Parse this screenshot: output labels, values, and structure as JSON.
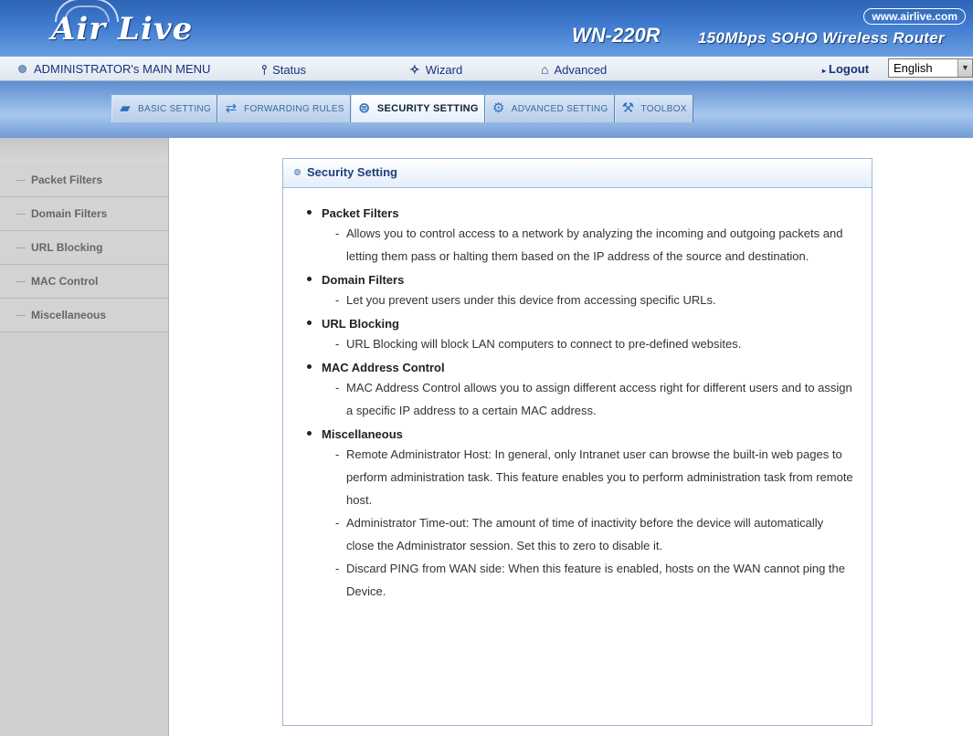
{
  "header": {
    "logo": "Air Live",
    "website": "www.airlive.com",
    "model": "WN-220R",
    "model_description": "150Mbps SOHO Wireless Router"
  },
  "top_menu": {
    "admin_label": "ADMINISTRATOR's MAIN MENU",
    "status": "Status",
    "wizard": "Wizard",
    "advanced": "Advanced",
    "logout": "Logout",
    "language": "English"
  },
  "tabs": [
    {
      "label": "BASIC SETTING",
      "icon": "folder-icon"
    },
    {
      "label": "FORWARDING RULES",
      "icon": "arrows-icon"
    },
    {
      "label": "SECURITY SETTING",
      "icon": "lock-icon"
    },
    {
      "label": "ADVANCED SETTING",
      "icon": "gear-icon"
    },
    {
      "label": "TOOLBOX",
      "icon": "toolbox-icon"
    }
  ],
  "sidebar": {
    "items": [
      "Packet Filters",
      "Domain Filters",
      "URL Blocking",
      "MAC Control",
      "Miscellaneous"
    ]
  },
  "panel": {
    "title": "Security Setting",
    "sections": [
      {
        "title": "Packet Filters",
        "descriptions": [
          "Allows you to control access to a network by analyzing the incoming and outgoing packets and letting them pass or halting them based on the IP address of the source and destination."
        ]
      },
      {
        "title": "Domain Filters",
        "descriptions": [
          "Let you prevent users under this device from accessing specific URLs."
        ]
      },
      {
        "title": "URL Blocking",
        "descriptions": [
          "URL Blocking will block LAN computers to connect to pre-defined websites."
        ]
      },
      {
        "title": "MAC Address Control",
        "descriptions": [
          "MAC Address Control allows you to assign different access right for different users and to assign a specific IP address to a certain MAC address."
        ]
      },
      {
        "title": "Miscellaneous",
        "descriptions": [
          "Remote Administrator Host: In general, only Intranet user can browse the built-in web pages to perform administration task. This feature enables you to perform administration task from remote host.",
          "Administrator Time-out: The amount of time of inactivity before the device will automatically close the Administrator session. Set this to zero to disable it.",
          "Discard PING from WAN side: When this feature is enabled, hosts on the WAN cannot ping the Device."
        ]
      }
    ]
  }
}
